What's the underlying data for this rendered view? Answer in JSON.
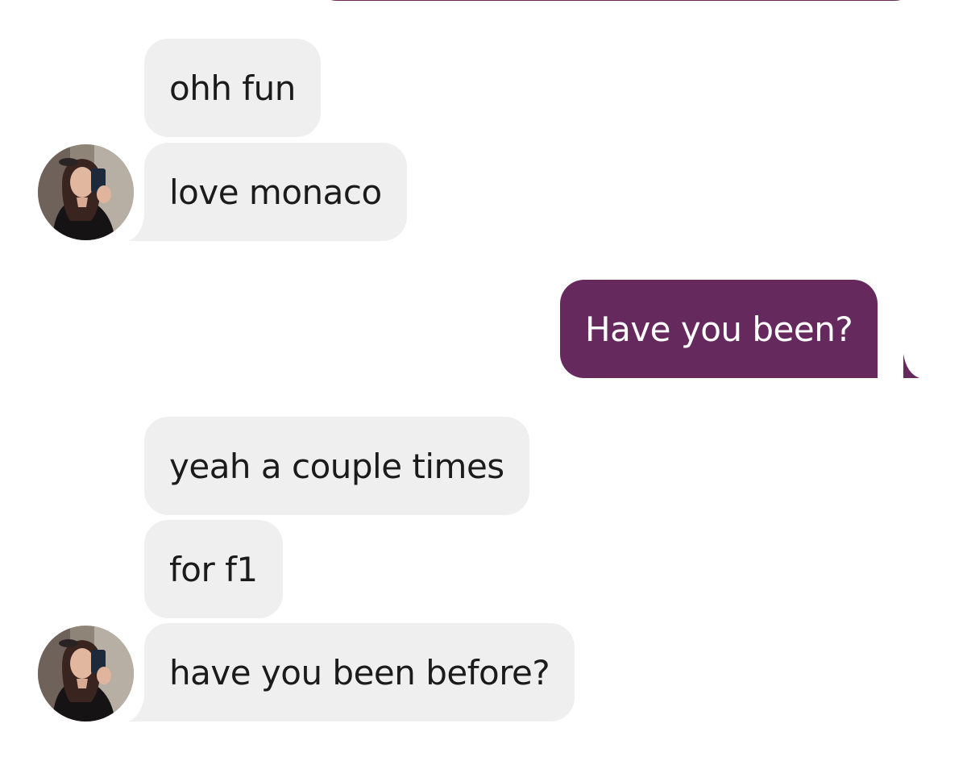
{
  "colors": {
    "incoming_bubble": "#efefef",
    "outgoing_bubble": "#65295e",
    "incoming_text": "#1b1b1b",
    "outgoing_text": "#ffffff"
  },
  "avatar_icon": "profile-photo-icon",
  "messages": [
    {
      "direction": "in",
      "text": "ohh fun"
    },
    {
      "direction": "in",
      "text": "love monaco"
    },
    {
      "direction": "out",
      "text": "Have you been?"
    },
    {
      "direction": "in",
      "text": "yeah a couple times"
    },
    {
      "direction": "in",
      "text": "for f1"
    },
    {
      "direction": "in",
      "text": "have you been before?"
    }
  ]
}
